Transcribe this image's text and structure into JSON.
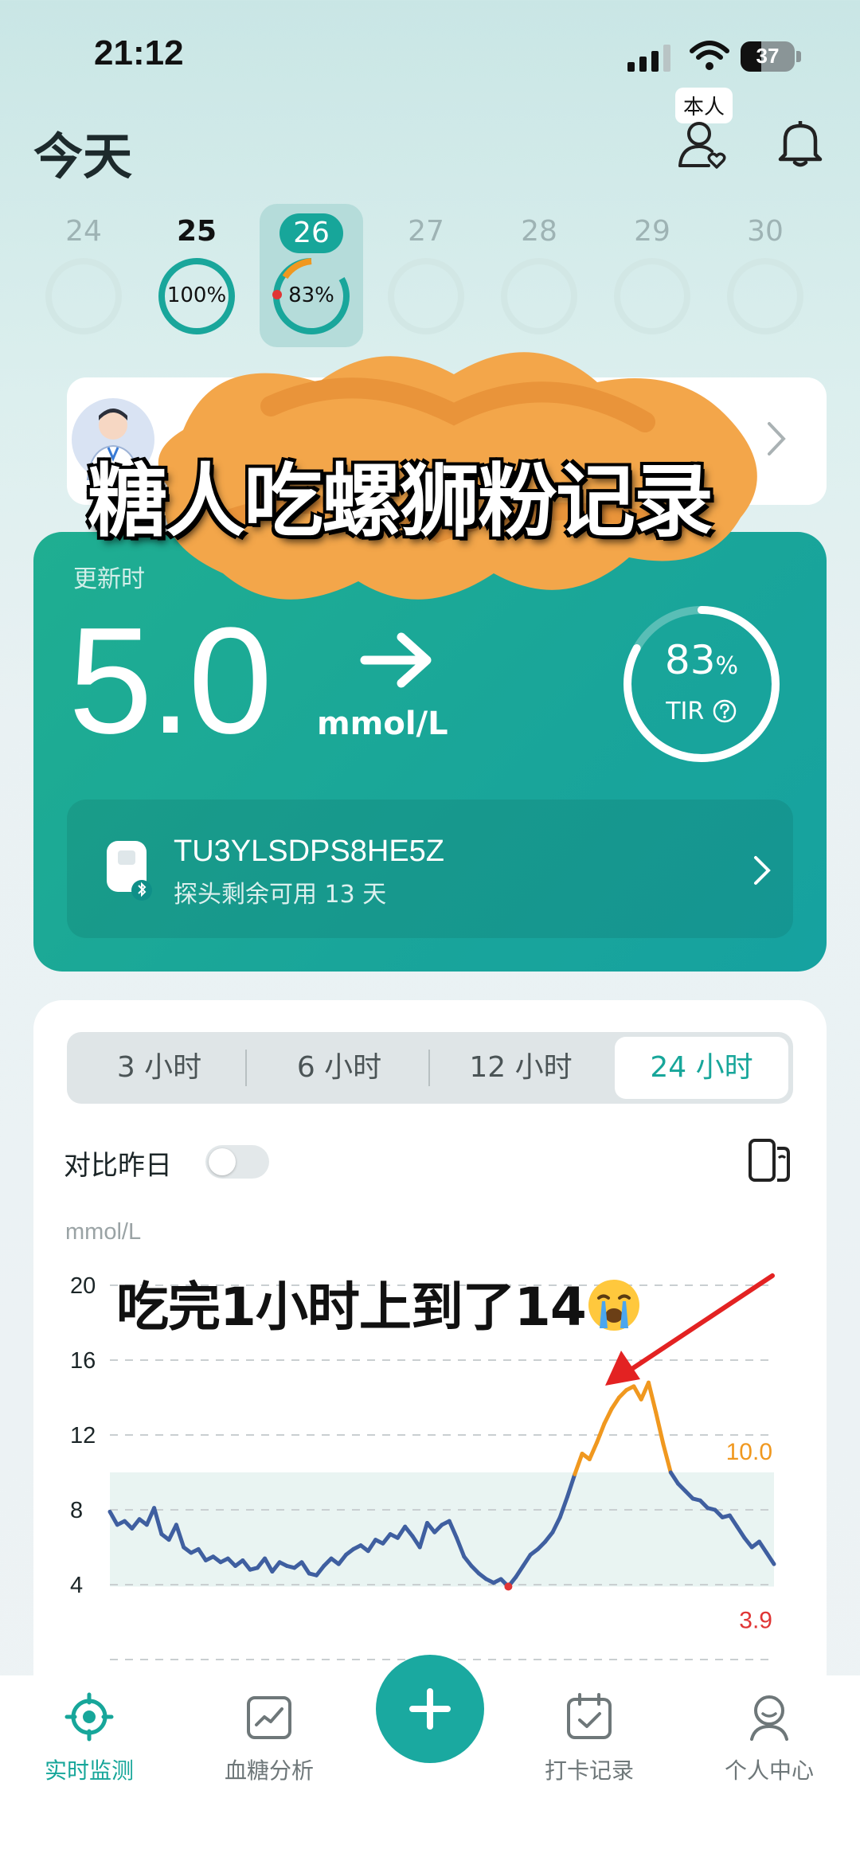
{
  "status_bar": {
    "time": "21:12",
    "battery": "37"
  },
  "header": {
    "title": "今天",
    "profile_tag": "本人"
  },
  "date_strip": [
    {
      "day": "24",
      "progress": null
    },
    {
      "day": "25",
      "progress": "100%"
    },
    {
      "day": "26",
      "progress": "83%",
      "selected": true
    },
    {
      "day": "27",
      "progress": null
    },
    {
      "day": "28",
      "progress": null
    },
    {
      "day": "29",
      "progress": null
    },
    {
      "day": "30",
      "progress": null
    }
  ],
  "overlay_title": "糖人吃螺狮粉记录",
  "glucose": {
    "update_label": "更新时",
    "value": "5.0",
    "unit": "mmol/L",
    "trend": "arrow-right-icon",
    "tir_value": "83",
    "tir_percent_sign": "%",
    "tir_label": "TIR",
    "sensor_id": "TU3YLSDPS8HE5Z",
    "sensor_days_left": "探头剩余可用 13 天"
  },
  "range_tabs": [
    "3 小时",
    "6 小时",
    "12 小时",
    "24 小时"
  ],
  "range_active": "24 小时",
  "compare": {
    "label": "对比昨日",
    "enabled": false
  },
  "chart_note": "吃完1小时上到了14",
  "chart_data": {
    "type": "line",
    "ylabel": "mmol/L",
    "yticks": [
      "20",
      "16",
      "12",
      "8",
      "4"
    ],
    "ylim": [
      0,
      20
    ],
    "target_range": [
      3.9,
      10.0
    ],
    "high_label": "10.0",
    "low_label": "3.9",
    "xlim_hours": [
      0,
      22.5
    ],
    "grid": true,
    "colors": {
      "normal": "#3f5fa0",
      "high": "#f0981f",
      "low": "#e03535",
      "band": "#e9f4f2"
    },
    "series": [
      {
        "points": [
          [
            0,
            7.9
          ],
          [
            0.25,
            7.2
          ],
          [
            0.5,
            7.4
          ],
          [
            0.75,
            7.0
          ],
          [
            1.0,
            7.5
          ],
          [
            1.25,
            7.2
          ],
          [
            1.5,
            8.1
          ],
          [
            1.75,
            6.7
          ],
          [
            2.0,
            6.4
          ],
          [
            2.25,
            7.2
          ],
          [
            2.5,
            6.0
          ],
          [
            2.75,
            5.7
          ],
          [
            3.0,
            5.9
          ],
          [
            3.25,
            5.3
          ],
          [
            3.5,
            5.5
          ],
          [
            3.75,
            5.2
          ],
          [
            4.0,
            5.4
          ],
          [
            4.25,
            5.0
          ],
          [
            4.5,
            5.3
          ],
          [
            4.75,
            4.8
          ],
          [
            5.0,
            4.9
          ],
          [
            5.25,
            5.4
          ],
          [
            5.5,
            4.7
          ],
          [
            5.75,
            5.2
          ],
          [
            6.0,
            5.0
          ],
          [
            6.25,
            4.9
          ],
          [
            6.5,
            5.2
          ],
          [
            6.75,
            4.6
          ],
          [
            7.0,
            4.5
          ],
          [
            7.25,
            5.0
          ],
          [
            7.5,
            5.4
          ],
          [
            7.75,
            5.1
          ],
          [
            8.0,
            5.6
          ],
          [
            8.25,
            5.9
          ],
          [
            8.5,
            6.1
          ],
          [
            8.75,
            5.8
          ],
          [
            9.0,
            6.4
          ],
          [
            9.25,
            6.2
          ],
          [
            9.5,
            6.7
          ],
          [
            9.75,
            6.5
          ],
          [
            10.0,
            7.1
          ],
          [
            10.25,
            6.6
          ],
          [
            10.5,
            6.0
          ],
          [
            10.75,
            7.3
          ],
          [
            11.0,
            6.8
          ],
          [
            11.25,
            7.2
          ],
          [
            11.5,
            7.4
          ],
          [
            11.75,
            6.5
          ],
          [
            12.0,
            5.5
          ],
          [
            12.25,
            5.0
          ],
          [
            12.5,
            4.6
          ],
          [
            12.75,
            4.3
          ],
          [
            13.0,
            4.1
          ],
          [
            13.25,
            4.3
          ],
          [
            13.5,
            3.9
          ],
          [
            13.75,
            4.4
          ],
          [
            14.0,
            5.0
          ],
          [
            14.25,
            5.6
          ],
          [
            14.5,
            5.9
          ],
          [
            14.75,
            6.3
          ],
          [
            15.0,
            6.8
          ],
          [
            15.25,
            7.6
          ],
          [
            15.5,
            8.7
          ],
          [
            15.75,
            9.9
          ],
          [
            16.0,
            11.0
          ],
          [
            16.25,
            10.7
          ],
          [
            16.5,
            11.6
          ],
          [
            16.75,
            12.6
          ],
          [
            17.0,
            13.4
          ],
          [
            17.25,
            14.0
          ],
          [
            17.5,
            14.4
          ],
          [
            17.75,
            14.6
          ],
          [
            18.0,
            13.9
          ],
          [
            18.25,
            14.8
          ],
          [
            18.5,
            13.2
          ],
          [
            18.75,
            11.5
          ],
          [
            19.0,
            10.0
          ],
          [
            19.25,
            9.4
          ],
          [
            19.5,
            9.0
          ],
          [
            19.75,
            8.6
          ],
          [
            20.0,
            8.5
          ],
          [
            20.25,
            8.1
          ],
          [
            20.5,
            8.0
          ],
          [
            20.75,
            7.6
          ],
          [
            21.0,
            7.7
          ],
          [
            21.25,
            7.1
          ],
          [
            21.5,
            6.5
          ],
          [
            21.75,
            6.0
          ],
          [
            22.0,
            6.3
          ],
          [
            22.25,
            5.7
          ],
          [
            22.5,
            5.1
          ]
        ]
      }
    ]
  },
  "nav": [
    {
      "label": "实时监测",
      "icon": "target-icon",
      "active": true
    },
    {
      "label": "血糖分析",
      "icon": "chart-icon",
      "active": false
    },
    {
      "label": "打卡记录",
      "icon": "calendar-check-icon",
      "active": false
    },
    {
      "label": "个人中心",
      "icon": "person-icon",
      "active": false
    }
  ]
}
